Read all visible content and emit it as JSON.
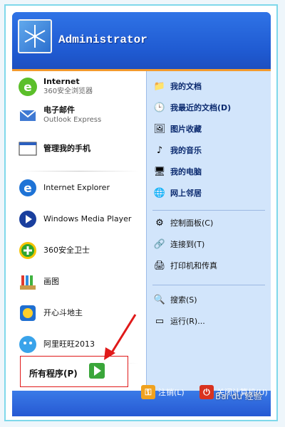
{
  "header": {
    "username": "Administrator"
  },
  "pinned": [
    {
      "title": "Internet",
      "subtitle": "360安全浏览器",
      "icon": "360-browser-icon"
    },
    {
      "title": "电子邮件",
      "subtitle": "Outlook Express",
      "icon": "outlook-icon"
    },
    {
      "title": "管理我的手机",
      "subtitle": "",
      "icon": "phone-manager-icon"
    }
  ],
  "recent": [
    {
      "label": "Internet Explorer",
      "icon": "ie-icon"
    },
    {
      "label": "Windows Media Player",
      "icon": "media-player-icon"
    },
    {
      "label": "360安全卫士",
      "icon": "360-safeguard-icon"
    },
    {
      "label": "画图",
      "icon": "paint-icon"
    },
    {
      "label": "开心斗地主",
      "icon": "card-game-icon"
    },
    {
      "label": "阿里旺旺2013",
      "icon": "aliwangwang-icon"
    }
  ],
  "all_programs": {
    "label": "所有程序(P)"
  },
  "right_items": [
    {
      "label": "我的文档",
      "icon": "my-documents-icon"
    },
    {
      "label": "我最近的文档(D)",
      "icon": "recent-documents-icon"
    },
    {
      "label": "图片收藏",
      "icon": "my-pictures-icon"
    },
    {
      "label": "我的音乐",
      "icon": "my-music-icon"
    },
    {
      "label": "我的电脑",
      "icon": "my-computer-icon"
    },
    {
      "label": "网上邻居",
      "icon": "network-places-icon"
    },
    {
      "label": "控制面板(C)",
      "icon": "control-panel-icon"
    },
    {
      "label": "连接到(T)",
      "icon": "connect-to-icon"
    },
    {
      "label": "打印机和传真",
      "icon": "printers-icon"
    },
    {
      "label": "搜索(S)",
      "icon": "search-icon"
    },
    {
      "label": "运行(R)...",
      "icon": "run-icon"
    }
  ],
  "footer": {
    "logoff": "注销(L)",
    "shutdown": "关闭计算机(U)"
  },
  "watermark": "Bai du 经验",
  "colors": {
    "header_blue": "#2f73e6",
    "accent_orange": "#f39a2d",
    "right_panel": "#d2e5fb",
    "highlight_red": "#e01919"
  }
}
